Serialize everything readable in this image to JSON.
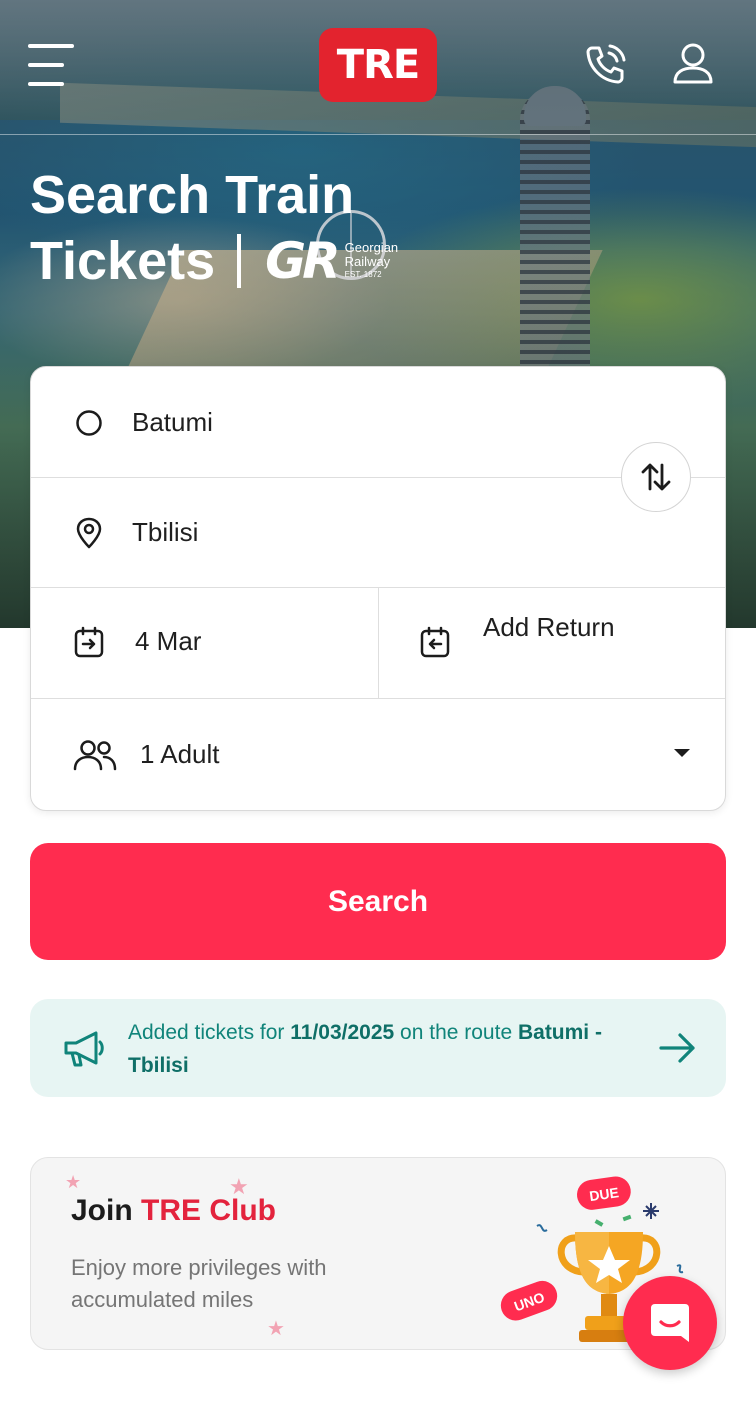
{
  "header": {
    "logo_text": "TRE",
    "menu_icon": "hamburger-menu-icon",
    "phone_icon": "phone-call-icon",
    "profile_icon": "user-profile-icon"
  },
  "hero": {
    "title_line1": "Search Train",
    "title_line2": "Tickets",
    "partner": {
      "mark": "GR",
      "name_line1": "Georgian",
      "name_line2": "Railway",
      "est": "EST. 1872"
    }
  },
  "search_form": {
    "from": "Batumi",
    "to": "Tbilisi",
    "depart_date": "4 Mar",
    "return_label": "Add Return",
    "passengers": "1 Adult",
    "search_label": "Search"
  },
  "notice": {
    "prefix": "Added tickets for ",
    "date": "11/03/2025",
    "middle": " on the route ",
    "route_from": "Batumi",
    "route_sep": " - ",
    "route_to": "Tbilisi"
  },
  "club": {
    "title_prefix": "Join ",
    "title_accent": "TRE Club",
    "subtitle": "Enjoy more privileges with accumulated miles",
    "badge_left": "UNO",
    "badge_right": "DUE"
  },
  "colors": {
    "brand_red": "#e3232e",
    "search_button": "#ff2c4f",
    "notice_bg": "#e7f5f3",
    "notice_text": "#10847a",
    "club_accent": "#e3233d"
  }
}
